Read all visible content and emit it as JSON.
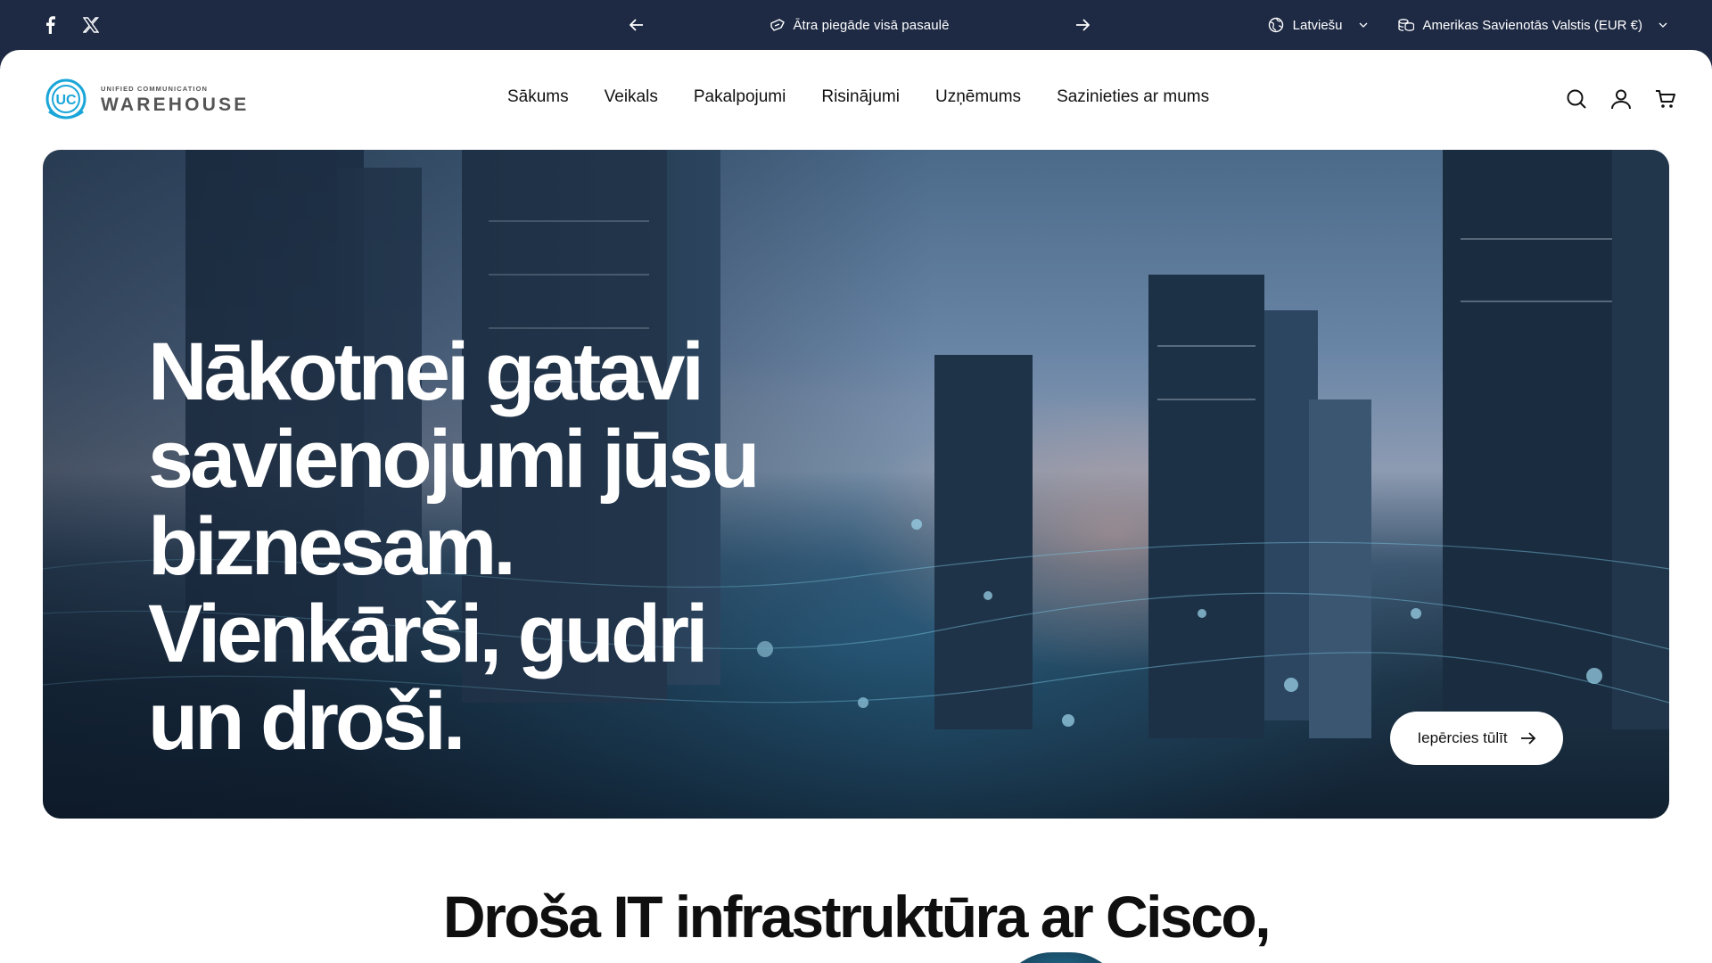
{
  "topbar": {
    "social": [
      {
        "icon": "facebook-icon"
      },
      {
        "icon": "x-twitter-icon"
      }
    ],
    "announcement": "Ātra piegāde visā pasaulē",
    "language": "Latviešu",
    "country_currency": "Amerikas Savienotās Valstis (EUR €)"
  },
  "header": {
    "logo": {
      "mark": "UC",
      "tagline": "UNIFIED COMMUNICATION",
      "brand": "WAREHOUSE"
    },
    "nav": [
      "Sākums",
      "Veikals",
      "Pakalpojumi",
      "Risinājumi",
      "Uzņēmums",
      "Sazinieties ar mums"
    ],
    "icons": [
      "search-icon",
      "account-icon",
      "cart-icon"
    ]
  },
  "hero": {
    "heading_lines": [
      "Nākotnei gatavi",
      "savienojumi jūsu",
      "biznesam.",
      "Vienkārši, gudri",
      "un droši."
    ],
    "cta_label": "Iepērcies tūlīt"
  },
  "section": {
    "title": "Droša IT infrastruktūra ar Cisco,"
  },
  "colors": {
    "topbar_bg": "#1e2a44",
    "logo_accent": "#1aa6d9"
  }
}
